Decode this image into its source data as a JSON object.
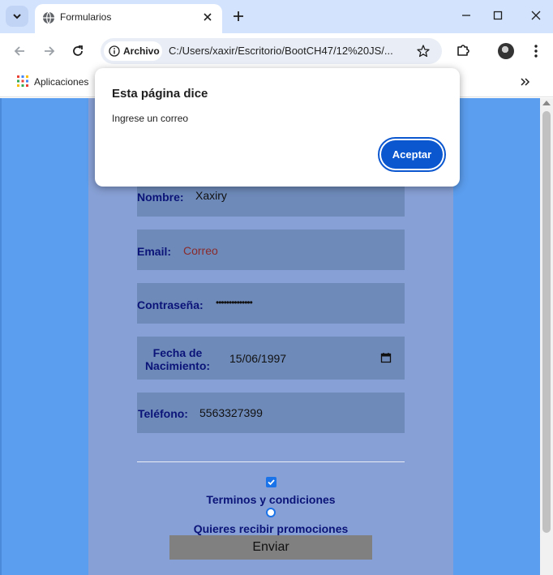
{
  "browser": {
    "tab": {
      "title": "Formularios"
    },
    "omnibox": {
      "chip_label": "Archivo",
      "url": "C:/Users/xaxir/Escritorio/BootCH47/12%20JS/..."
    },
    "bookmarks": {
      "apps_label": "Aplicaciones"
    },
    "icons": {
      "tab_search": "chevron-down-icon",
      "favicon": "globe-icon",
      "back": "arrow-left-icon",
      "forward": "arrow-right-icon",
      "reload": "reload-icon",
      "info": "info-icon",
      "bookmark": "star-icon",
      "extensions": "puzzle-icon",
      "menu": "kebab-icon"
    }
  },
  "dialog": {
    "title": "Esta página dice",
    "message": "Ingrese un correo",
    "ok_label": "Aceptar"
  },
  "form": {
    "fields": [
      {
        "label": "Nombre:",
        "value": "Xaxiry"
      },
      {
        "label": "Email:",
        "placeholder": "Correo"
      },
      {
        "label": "Contraseña:",
        "value": "••••••••••••••"
      },
      {
        "label_line1": "Fecha de",
        "label_line2": "Nacimiento:",
        "value": "15/06/1997"
      },
      {
        "label": "Teléfono:",
        "value": "5563327399"
      }
    ],
    "terms_label": "Terminos y condiciones",
    "terms_checked": true,
    "promo_label": "Quieres recibir promociones",
    "submit_label": "Enviar"
  },
  "colors": {
    "page_background": "#5b9dee",
    "form_panel": "#87a0d5",
    "field_background": "#6e8ab9",
    "label_text": "#0b1478",
    "dialog_button": "#0b57d0"
  }
}
